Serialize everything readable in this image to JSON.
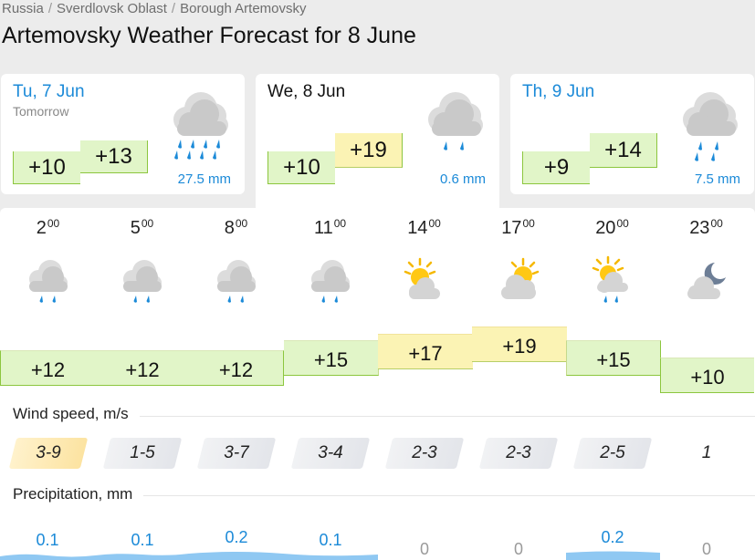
{
  "breadcrumb": [
    "Russia",
    "Sverdlovsk Oblast",
    "Borough Artemovsky"
  ],
  "page_title": "Artemovsky Weather Forecast for 8 June",
  "days": [
    {
      "date": "Tu, 7 Jun",
      "sub": "Tomorrow",
      "t_min": "+10",
      "t_max": "+13",
      "precip": "27.5 mm",
      "icon": "cloud-heavy-rain-icon"
    },
    {
      "date": "We, 8 Jun",
      "sub": "",
      "t_min": "+10",
      "t_max": "+19",
      "precip": "0.6 mm",
      "icon": "cloud-light-rain-icon"
    },
    {
      "date": "Th, 9 Jun",
      "sub": "",
      "t_min": "+9",
      "t_max": "+14",
      "precip": "7.5 mm",
      "icon": "cloud-rain-icon"
    }
  ],
  "hours": [
    {
      "h": "2",
      "m": "00",
      "temp": "+12",
      "wind": "3-9",
      "precip": "0.1",
      "icon": "cloud-rain-icon"
    },
    {
      "h": "5",
      "m": "00",
      "temp": "+12",
      "wind": "1-5",
      "precip": "0.1",
      "icon": "cloud-rain-icon"
    },
    {
      "h": "8",
      "m": "00",
      "temp": "+12",
      "wind": "3-7",
      "precip": "0.2",
      "icon": "cloud-rain-icon"
    },
    {
      "h": "11",
      "m": "00",
      "temp": "+15",
      "wind": "3-4",
      "precip": "0.1",
      "icon": "cloud-rain-icon"
    },
    {
      "h": "14",
      "m": "00",
      "temp": "+17",
      "wind": "2-3",
      "precip": "0",
      "icon": "sun-cloud-icon"
    },
    {
      "h": "17",
      "m": "00",
      "temp": "+19",
      "wind": "2-3",
      "precip": "0",
      "icon": "sun-cloud-icon"
    },
    {
      "h": "20",
      "m": "00",
      "temp": "+15",
      "wind": "2-5",
      "precip": "0.2",
      "icon": "sun-cloud-rain-icon"
    },
    {
      "h": "23",
      "m": "00",
      "temp": "+10",
      "wind": "1",
      "precip": "0",
      "icon": "moon-cloud-icon"
    }
  ],
  "wind_label": "Wind speed, m/s",
  "precip_label": "Precipitation, mm",
  "colors": {
    "accent": "#1b8ad8",
    "warm": "#fbf3b4",
    "cool": "#e1f5c8"
  }
}
